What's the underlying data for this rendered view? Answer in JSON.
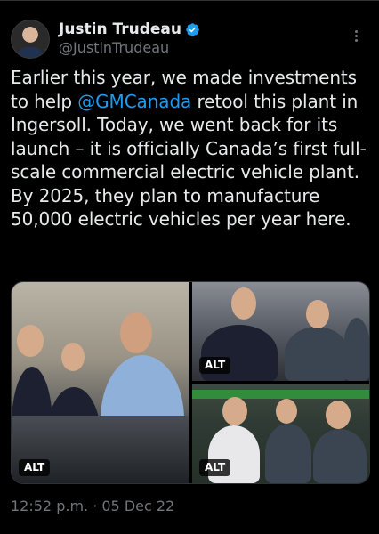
{
  "author": {
    "display_name": "Justin Trudeau",
    "handle": "@JustinTrudeau"
  },
  "tweet": {
    "text_1": "Earlier this year, we made investments to help ",
    "mention": "@GMCanada",
    "text_2": " retool this plant in Ingersoll. Today, we went back for its launch – it is officially Canada’s first full-scale commercial electric vehicle plant. By 2025, they plan to manufacture 50,000 electric vehicles per year here."
  },
  "media": {
    "alt_label": "ALT"
  },
  "timestamp": "12:52 p.m. · 05 Dec 22",
  "colors": {
    "background": "#000000",
    "text": "#e7e9ea",
    "secondary": "#71767b",
    "link": "#1d9bf0",
    "verified": "#1d9bf0"
  },
  "icons": [
    "verified-badge-icon",
    "more-options-icon"
  ]
}
